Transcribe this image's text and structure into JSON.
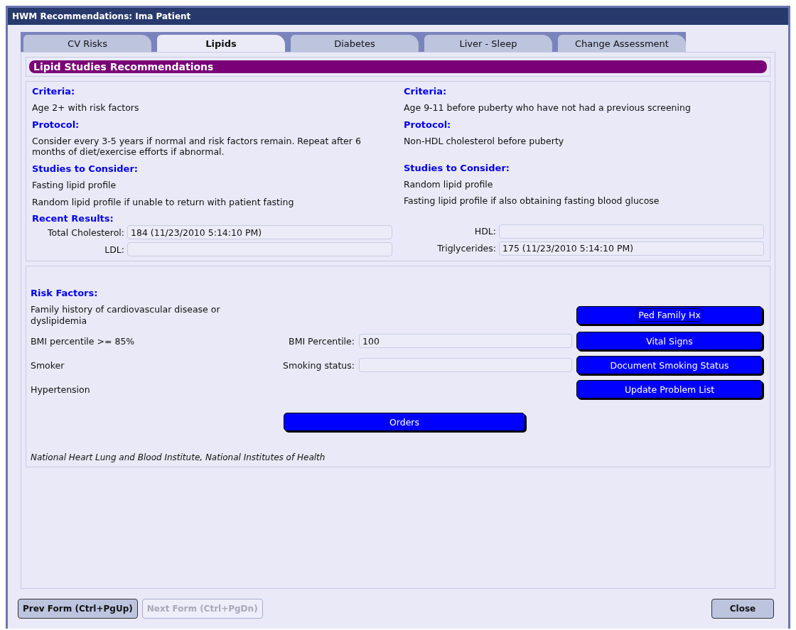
{
  "window": {
    "title": "HWM Recommendations:  Ima Patient"
  },
  "tabs": [
    {
      "label": "CV Risks",
      "selected": false
    },
    {
      "label": "Lipids",
      "selected": true
    },
    {
      "label": "Diabetes",
      "selected": false
    },
    {
      "label": "Liver - Sleep",
      "selected": false
    },
    {
      "label": "Change Assessment",
      "selected": false
    }
  ],
  "header": "Lipid Studies Recommendations",
  "columns": [
    {
      "criteria_label": "Criteria:",
      "criteria": "Age 2+ with risk factors",
      "protocol_label": "Protocol:",
      "protocol": "Consider every 3-5 years if normal and risk factors remain.  Repeat after 6 months of diet/exercise efforts if abnormal.",
      "studies_label": "Studies to Consider:",
      "studies": [
        "Fasting lipid profile",
        "Random lipid profile if unable to return with patient fasting"
      ],
      "results_label": "Recent Results:",
      "results": [
        {
          "label": "Total Cholesterol:",
          "value": "184 (11/23/2010 5:14:10 PM)"
        },
        {
          "label": "LDL:"
        }
      ]
    },
    {
      "criteria_label": "Criteria:",
      "criteria": "Age 9-11 before puberty who have not had a previous screening",
      "protocol_label": "Protocol:",
      "protocol": "Non-HDL cholesterol before puberty",
      "studies_label": "Studies to Consider:",
      "studies": [
        "Random lipid profile",
        "Fasting lipid profile if also obtaining fasting blood glucose"
      ],
      "results": [
        {
          "label": "HDL:"
        },
        {
          "label": "Triglycerides:",
          "value": "175 (11/23/2010 5:14:10 PM)"
        }
      ]
    }
  ],
  "risk_factors_label": "Risk Factors:",
  "risk_factors": [
    {
      "text": "Family history of cardiovascular disease or dyslipidemia",
      "button": {
        "label": "Ped Family Hx",
        "focused": true
      }
    },
    {
      "text": "BMI percentile >= 85%",
      "field": {
        "label": "BMI Percentile:",
        "value": "100"
      },
      "button": {
        "label": "Vital Signs",
        "focused": false
      }
    },
    {
      "text": "Smoker",
      "field": {
        "label": "Smoking status:"
      },
      "button": {
        "label": "Document Smoking Status",
        "focused": false
      }
    },
    {
      "text": "Hypertension",
      "button": {
        "label": "Update Problem List",
        "focused": false
      }
    }
  ],
  "orders_button": "Orders",
  "source": "National Heart Lung and Blood Institute, National Institutes of Health",
  "footer_buttons": [
    {
      "label": "Prev Form (Ctrl+PgUp)",
      "disabled": false
    },
    {
      "label": "Next Form (Ctrl+PgDn)",
      "disabled": true
    }
  ],
  "close_button": "Close"
}
